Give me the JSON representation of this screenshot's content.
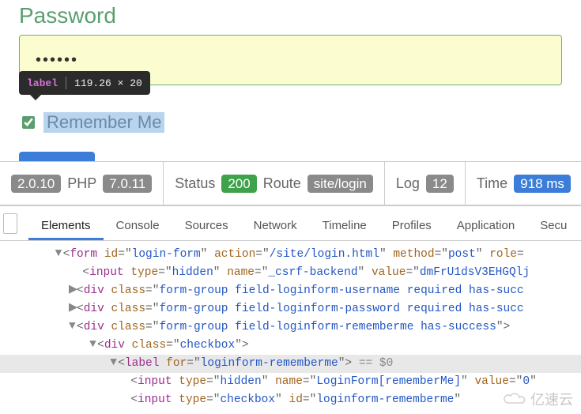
{
  "form": {
    "password_label": "Password",
    "password_value": "••••••",
    "remember_label": "Remember Me",
    "remember_checked": true
  },
  "inspect_tooltip": {
    "tag": "label",
    "dimensions": "119.26 × 20"
  },
  "debug_bar": {
    "yii_version": "2.0.10",
    "php_label": "PHP",
    "php_version": "7.0.11",
    "status_label": "Status",
    "status_code": "200",
    "route_label": "Route",
    "route_value": "site/login",
    "log_label": "Log",
    "log_count": "12",
    "time_label": "Time",
    "time_value": "918 ms"
  },
  "devtools": {
    "tabs": [
      "Elements",
      "Console",
      "Sources",
      "Network",
      "Timeline",
      "Profiles",
      "Application",
      "Secu"
    ],
    "active_tab": 0,
    "selected_hint": "== $0",
    "dom": {
      "form": {
        "tag": "form",
        "id": "login-form",
        "action": "/site/login.html",
        "method": "post",
        "role_attr": "role"
      },
      "csrf": {
        "tag": "input",
        "type": "hidden",
        "name": "_csrf-backend",
        "value_prefix": "dmFrU1dsV3EHGQlj"
      },
      "div_user": "form-group field-loginform-username required has-succ",
      "div_pass": "form-group field-loginform-password required has-succ",
      "div_remember": "form-group field-loginform-rememberme has-success",
      "div_checkbox": "checkbox",
      "label_for": "loginform-rememberme",
      "hidden_remember": {
        "type": "hidden",
        "name": "LoginForm[rememberMe]",
        "value": "0"
      },
      "checkbox_remember": {
        "type": "checkbox",
        "id": "loginform-rememberme"
      }
    }
  },
  "watermark": "亿速云"
}
